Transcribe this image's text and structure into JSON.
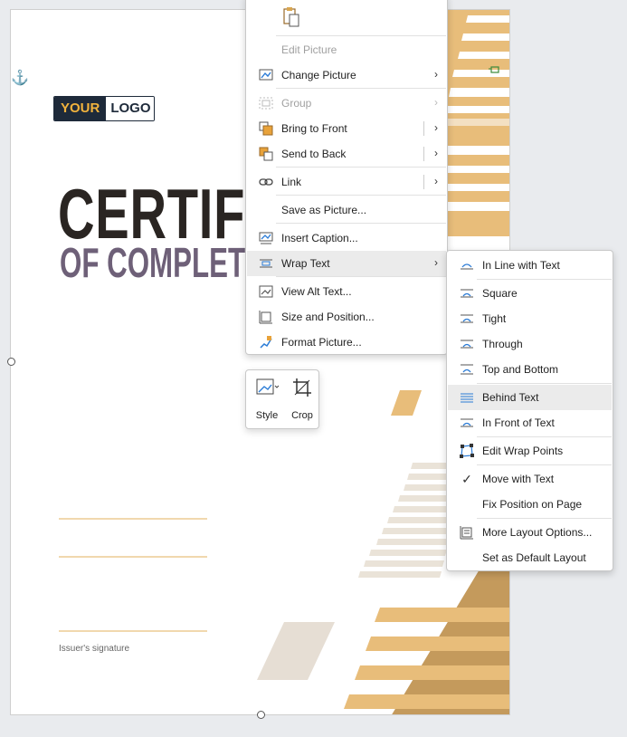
{
  "document": {
    "logo_part1": "YOUR",
    "logo_part2": "LOGO",
    "title_line1": "CERTIFIC",
    "title_line2": "OF COMPLETIO",
    "signature_label": "Issuer's signature"
  },
  "context_menu": {
    "paste_icon": "paste-icon",
    "items": [
      {
        "label": "Edit Picture",
        "icon": "edit-picture-icon",
        "disabled": true
      },
      {
        "label": "Change Picture",
        "icon": "change-picture-icon",
        "submenu": true
      },
      {
        "label": "Group",
        "icon": "group-icon",
        "disabled": true,
        "submenu": true
      },
      {
        "label": "Bring to Front",
        "icon": "bring-to-front-icon",
        "submenu": true
      },
      {
        "label": "Send to Back",
        "icon": "send-to-back-icon",
        "submenu": true
      },
      {
        "label": "Link",
        "icon": "link-icon",
        "submenu": true
      },
      {
        "label": "Save as Picture...",
        "icon": ""
      },
      {
        "label": "Insert Caption...",
        "icon": "insert-caption-icon"
      },
      {
        "label": "Wrap Text",
        "icon": "wrap-text-icon",
        "submenu": true,
        "highlighted": true
      },
      {
        "label": "View Alt Text...",
        "icon": "alt-text-icon"
      },
      {
        "label": "Size and Position...",
        "icon": "size-position-icon"
      },
      {
        "label": "Format Picture...",
        "icon": "format-picture-icon"
      }
    ]
  },
  "mini_toolbar": {
    "style_label": "Style",
    "crop_label": "Crop"
  },
  "wrap_submenu": {
    "items": [
      {
        "label": "In Line with Text",
        "icon": "inline-wrap-icon"
      },
      {
        "label": "Square",
        "icon": "square-wrap-icon"
      },
      {
        "label": "Tight",
        "icon": "tight-wrap-icon"
      },
      {
        "label": "Through",
        "icon": "through-wrap-icon"
      },
      {
        "label": "Top and Bottom",
        "icon": "top-bottom-wrap-icon"
      },
      {
        "label": "Behind Text",
        "icon": "behind-text-icon",
        "highlighted": true
      },
      {
        "label": "In Front of Text",
        "icon": "in-front-text-icon"
      },
      {
        "label": "Edit Wrap Points",
        "icon": "edit-wrap-points-icon"
      },
      {
        "label": "Move with Text",
        "icon": "checkmark-icon",
        "checked": true
      },
      {
        "label": "Fix Position on Page",
        "icon": ""
      },
      {
        "label": "More Layout Options...",
        "icon": "layout-options-icon"
      },
      {
        "label": "Set as Default Layout",
        "icon": ""
      }
    ]
  },
  "colors": {
    "accent_gold": "#e8bd7a",
    "accent_dark_gold": "#c49a5c",
    "stripe_light": "#eae3d8",
    "title_dark": "#2a2522",
    "title_purple": "#6e6078"
  }
}
